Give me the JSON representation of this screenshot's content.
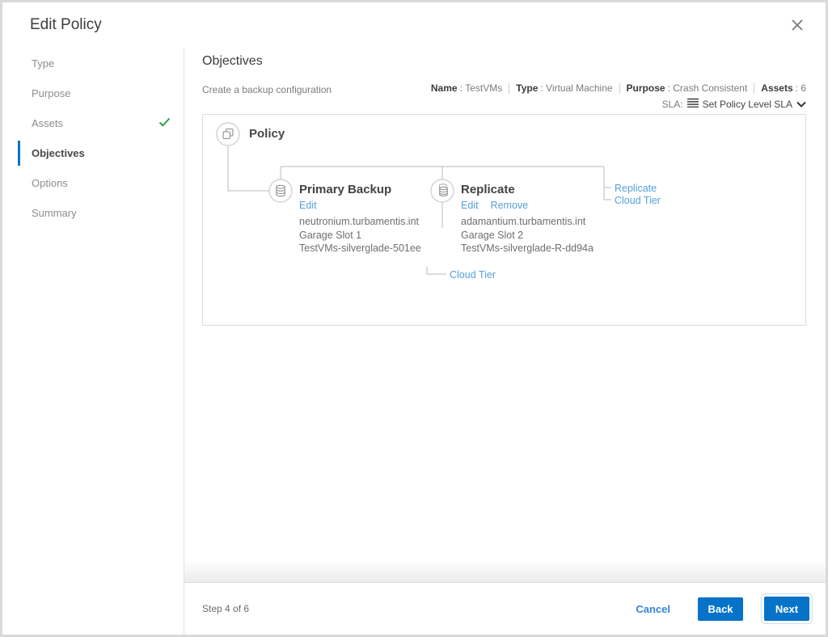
{
  "window": {
    "title": "Edit Policy",
    "close_icon": "close-icon"
  },
  "sidebar": {
    "items": [
      {
        "label": "Type",
        "completed": false,
        "active": false
      },
      {
        "label": "Purpose",
        "completed": false,
        "active": false
      },
      {
        "label": "Assets",
        "completed": true,
        "active": false
      },
      {
        "label": "Objectives",
        "completed": false,
        "active": true
      },
      {
        "label": "Options",
        "completed": false,
        "active": false
      },
      {
        "label": "Summary",
        "completed": false,
        "active": false
      }
    ]
  },
  "main": {
    "heading": "Objectives",
    "subtitle": "Create a backup configuration"
  },
  "summary_bar": {
    "fields": [
      {
        "label": "Name",
        "value": "TestVMs"
      },
      {
        "label": "Type",
        "value": "Virtual Machine"
      },
      {
        "label": "Purpose",
        "value": "Crash Consistent"
      },
      {
        "label": "Assets",
        "value": "6"
      }
    ],
    "sla_label": "SLA:",
    "sla_icon": "list-icon",
    "sla_value": "Set Policy Level SLA",
    "sla_chevron": "chevron-down-icon"
  },
  "diagram": {
    "root": {
      "label": "Policy",
      "icon": "copy-icon"
    },
    "stages": [
      {
        "title": "Primary Backup",
        "icon": "database-icon",
        "actions": [
          "Edit"
        ],
        "details": [
          "neutronium.turbamentis.int",
          "Garage Slot 1",
          "TestVMs-silverglade-501ee"
        ]
      },
      {
        "title": "Replicate",
        "icon": "database-copy-icon",
        "actions": [
          "Edit",
          "Remove"
        ],
        "details": [
          "adamantium.turbamentis.int",
          "Garage Slot 2",
          "TestVMs-silverglade-R-dd94a"
        ],
        "child_action": "Cloud Tier"
      }
    ],
    "add_actions": [
      "Replicate",
      "Cloud Tier"
    ]
  },
  "footer": {
    "step_text": "Step 4 of 6",
    "cancel_label": "Cancel",
    "back_label": "Back",
    "next_label": "Next"
  },
  "colors": {
    "accent": "#0673c9",
    "link": "#55a1da",
    "success": "#2da044"
  }
}
